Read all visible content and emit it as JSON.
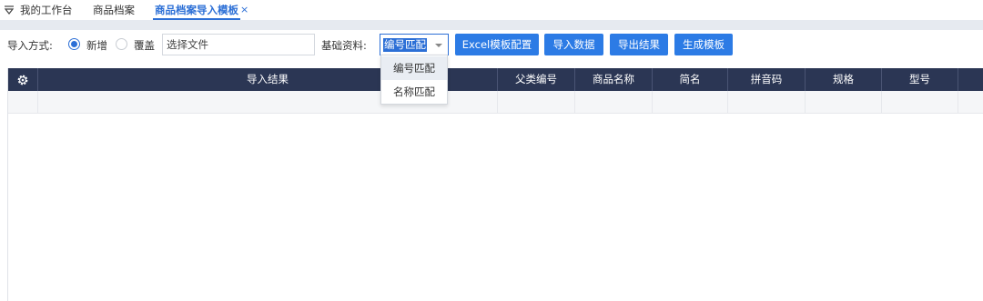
{
  "tabs": {
    "items": [
      {
        "label": "我的工作台",
        "icon": "filter-funnel-icon"
      },
      {
        "label": "商品档案"
      },
      {
        "label": "商品档案导入模板"
      }
    ],
    "close_glyph": "×",
    "active_color": "#2c6fd6"
  },
  "toolbar": {
    "import_mode_label": "导入方式:",
    "radio_new_label": "新增",
    "radio_new_checked": true,
    "radio_overwrite_label": "覆盖",
    "radio_overwrite_checked": false,
    "file_input_value": "选择文件",
    "base_data_label": "基础资料:",
    "select_value": "编号匹配",
    "select_options": [
      "编号匹配",
      "名称匹配"
    ],
    "buttons": {
      "excel_config": "Excel模板配置",
      "import_data": "导入数据",
      "export_result": "导出结果",
      "generate_template": "生成模板"
    },
    "button_color": "#2c7be5"
  },
  "grid": {
    "settings_icon": "gear-icon",
    "columns": [
      "导入结果",
      "父类编号",
      "商品名称",
      "简名",
      "拼音码",
      "规格",
      "型号"
    ],
    "header_color": "#2b3654"
  }
}
